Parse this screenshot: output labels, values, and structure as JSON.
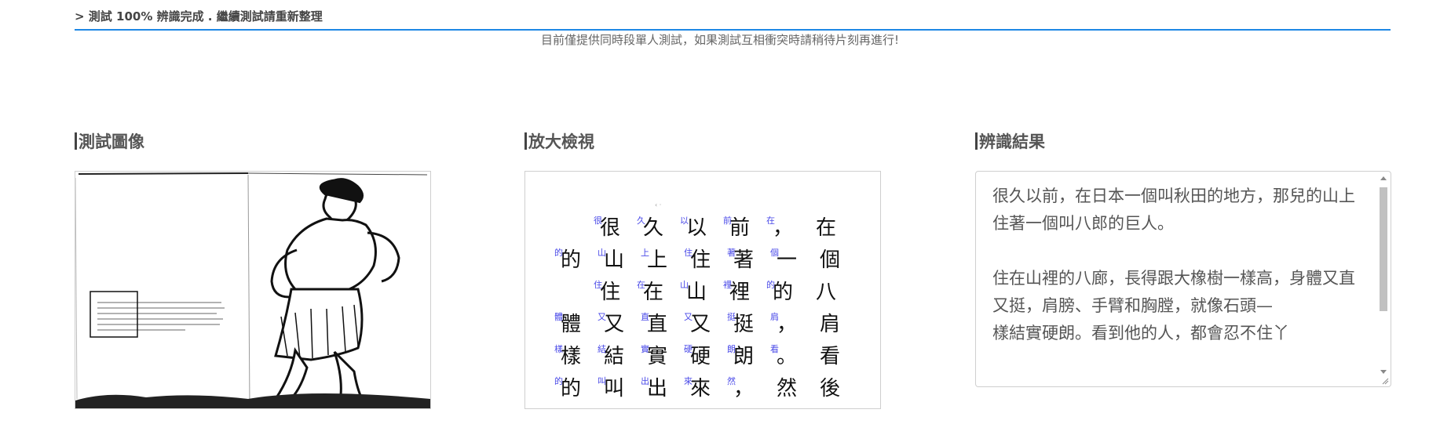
{
  "status_text": "> 測試 100% 辨識完成 . 繼續測試請重新整理",
  "notice_text": "目前僅提供同時段單人測試，如果測試互相衝突時請稍待片刻再進行!",
  "columns": {
    "test_image_title": "測試圖像",
    "zoom_title": "放大檢視",
    "result_title": "辨識結果"
  },
  "zoom_lines": [
    "很久以前，在",
    "的山上住著一個",
    "住在山裡的八",
    "體又直又挺，肩",
    "樣結實硬朗。看",
    "的叫出來，然後"
  ],
  "zoom_annotations": [
    [
      "很",
      "久",
      "以",
      "前",
      "在"
    ],
    [
      "的",
      "山",
      "上",
      "住",
      "著",
      "個"
    ],
    [
      "住",
      "在",
      "山",
      "裡",
      "的"
    ],
    [
      "體",
      "又",
      "直",
      "又",
      "挺",
      "肩"
    ],
    [
      "樣",
      "結",
      "實",
      "硬",
      "朗",
      "看"
    ],
    [
      "的",
      "叫",
      "出",
      "來",
      "然"
    ]
  ],
  "result_text": "很久以前，在日本一個叫秋田的地方，那兒的山上住著一個叫八郎的巨人。\n\n住在山裡的八廊，長得跟大橡樹一樣高，身體又直又挺，肩膀、手臂和胸膛，就像石頭—\n樣結實硬朗。看到他的人，都會忍不住丫"
}
